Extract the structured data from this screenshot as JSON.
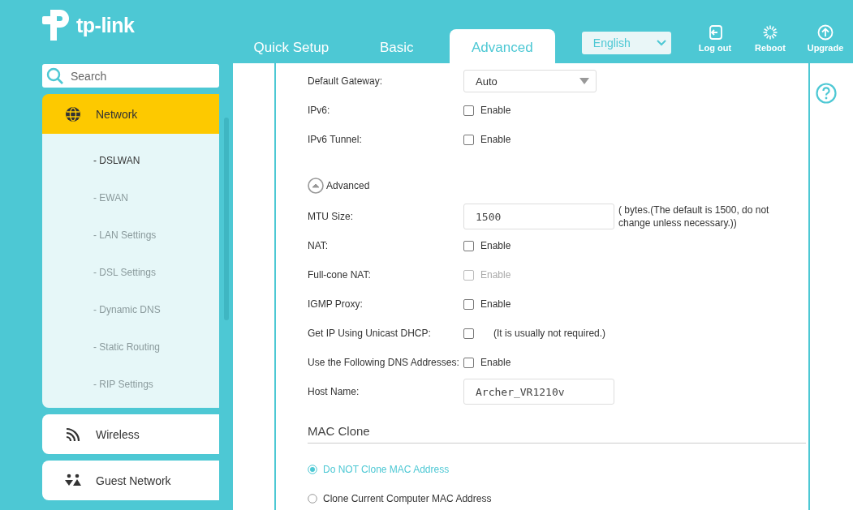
{
  "header": {
    "logo": "tp-link",
    "tabs": [
      {
        "label": "Quick Setup",
        "selected": false
      },
      {
        "label": "Basic",
        "selected": false
      },
      {
        "label": "Advanced",
        "selected": true
      }
    ],
    "language": "English",
    "actions": [
      {
        "kind": "logout",
        "label": "Log out"
      },
      {
        "kind": "reboot",
        "label": "Reboot"
      },
      {
        "kind": "upgrade",
        "label": "Upgrade"
      }
    ]
  },
  "sidebar": {
    "search": {
      "placeholder": "Search"
    },
    "items": [
      {
        "kind": "globe",
        "label": "Network",
        "selected": true,
        "expanded": true,
        "children": [
          {
            "label": "- DSLWAN",
            "selected": true
          },
          {
            "label": "- EWAN",
            "selected": false
          },
          {
            "label": "- LAN Settings",
            "selected": false
          },
          {
            "label": "- DSL Settings",
            "selected": false
          },
          {
            "label": "- Dynamic DNS",
            "selected": false
          },
          {
            "label": "- Static Routing",
            "selected": false
          },
          {
            "label": "- RIP Settings",
            "selected": false
          }
        ]
      },
      {
        "kind": "wifi",
        "label": "Wireless",
        "selected": false,
        "expanded": false
      },
      {
        "kind": "people",
        "label": "Guest Network",
        "selected": false,
        "expanded": false
      }
    ]
  },
  "form": {
    "rows": [
      {
        "kind": "select",
        "label": "Default Gateway:",
        "value": "Auto"
      },
      {
        "kind": "checkbox",
        "label": "IPv6:",
        "option": "Enable",
        "checked": false,
        "disabled": false
      },
      {
        "kind": "checkbox",
        "label": "IPv6 Tunnel:",
        "option": "Enable",
        "checked": false,
        "disabled": false
      },
      {
        "kind": "expander",
        "label": "Advanced",
        "expanded": true
      },
      {
        "kind": "text",
        "label": "MTU Size:",
        "value": "1500",
        "note": "( bytes.(The default is 1500, do not change unless necessary.))"
      },
      {
        "kind": "checkbox",
        "label": "NAT:",
        "option": "Enable",
        "checked": false,
        "disabled": false
      },
      {
        "kind": "checkbox",
        "label": "Full-cone NAT:",
        "option": "Enable",
        "checked": false,
        "disabled": true
      },
      {
        "kind": "checkbox",
        "label": "IGMP Proxy:",
        "option": "Enable",
        "checked": false,
        "disabled": false
      },
      {
        "kind": "checkbox",
        "label": "Get IP Using Unicast DHCP:",
        "note": "(It is usually not required.)",
        "checked": false,
        "disabled": false
      },
      {
        "kind": "checkbox",
        "label": "Use the Following DNS Addresses:",
        "option": "Enable",
        "checked": false,
        "disabled": false
      },
      {
        "kind": "text",
        "label": "Host Name:",
        "value": "Archer_VR1210v"
      },
      {
        "kind": "section",
        "label": "MAC Clone"
      },
      {
        "kind": "radio",
        "label": "Do NOT Clone MAC Address",
        "selected": true
      },
      {
        "kind": "radio",
        "label": "Clone Current Computer MAC Address",
        "selected": false
      }
    ]
  }
}
